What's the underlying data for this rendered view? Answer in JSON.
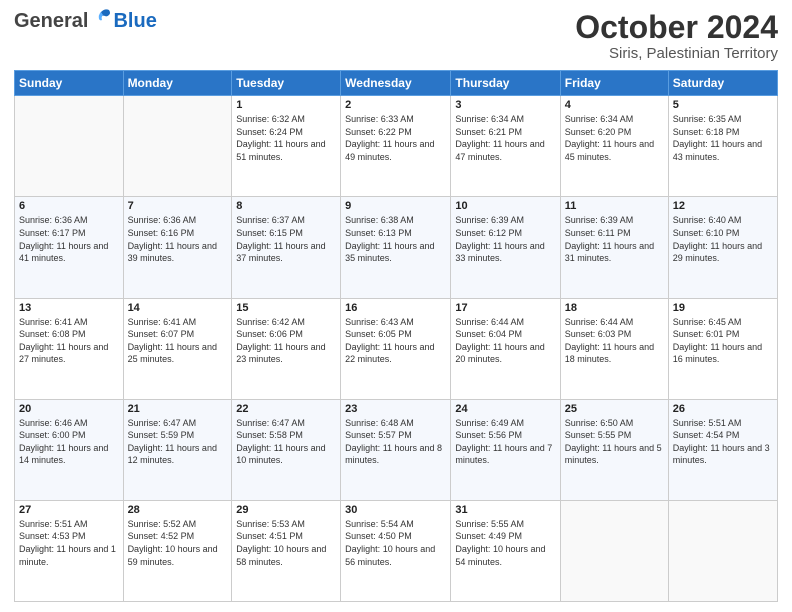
{
  "header": {
    "logo_general": "General",
    "logo_blue": "Blue",
    "month_title": "October 2024",
    "location": "Siris, Palestinian Territory"
  },
  "days_of_week": [
    "Sunday",
    "Monday",
    "Tuesday",
    "Wednesday",
    "Thursday",
    "Friday",
    "Saturday"
  ],
  "weeks": [
    [
      {
        "day": "",
        "info": ""
      },
      {
        "day": "",
        "info": ""
      },
      {
        "day": "1",
        "info": "Sunrise: 6:32 AM\nSunset: 6:24 PM\nDaylight: 11 hours and 51 minutes."
      },
      {
        "day": "2",
        "info": "Sunrise: 6:33 AM\nSunset: 6:22 PM\nDaylight: 11 hours and 49 minutes."
      },
      {
        "day": "3",
        "info": "Sunrise: 6:34 AM\nSunset: 6:21 PM\nDaylight: 11 hours and 47 minutes."
      },
      {
        "day": "4",
        "info": "Sunrise: 6:34 AM\nSunset: 6:20 PM\nDaylight: 11 hours and 45 minutes."
      },
      {
        "day": "5",
        "info": "Sunrise: 6:35 AM\nSunset: 6:18 PM\nDaylight: 11 hours and 43 minutes."
      }
    ],
    [
      {
        "day": "6",
        "info": "Sunrise: 6:36 AM\nSunset: 6:17 PM\nDaylight: 11 hours and 41 minutes."
      },
      {
        "day": "7",
        "info": "Sunrise: 6:36 AM\nSunset: 6:16 PM\nDaylight: 11 hours and 39 minutes."
      },
      {
        "day": "8",
        "info": "Sunrise: 6:37 AM\nSunset: 6:15 PM\nDaylight: 11 hours and 37 minutes."
      },
      {
        "day": "9",
        "info": "Sunrise: 6:38 AM\nSunset: 6:13 PM\nDaylight: 11 hours and 35 minutes."
      },
      {
        "day": "10",
        "info": "Sunrise: 6:39 AM\nSunset: 6:12 PM\nDaylight: 11 hours and 33 minutes."
      },
      {
        "day": "11",
        "info": "Sunrise: 6:39 AM\nSunset: 6:11 PM\nDaylight: 11 hours and 31 minutes."
      },
      {
        "day": "12",
        "info": "Sunrise: 6:40 AM\nSunset: 6:10 PM\nDaylight: 11 hours and 29 minutes."
      }
    ],
    [
      {
        "day": "13",
        "info": "Sunrise: 6:41 AM\nSunset: 6:08 PM\nDaylight: 11 hours and 27 minutes."
      },
      {
        "day": "14",
        "info": "Sunrise: 6:41 AM\nSunset: 6:07 PM\nDaylight: 11 hours and 25 minutes."
      },
      {
        "day": "15",
        "info": "Sunrise: 6:42 AM\nSunset: 6:06 PM\nDaylight: 11 hours and 23 minutes."
      },
      {
        "day": "16",
        "info": "Sunrise: 6:43 AM\nSunset: 6:05 PM\nDaylight: 11 hours and 22 minutes."
      },
      {
        "day": "17",
        "info": "Sunrise: 6:44 AM\nSunset: 6:04 PM\nDaylight: 11 hours and 20 minutes."
      },
      {
        "day": "18",
        "info": "Sunrise: 6:44 AM\nSunset: 6:03 PM\nDaylight: 11 hours and 18 minutes."
      },
      {
        "day": "19",
        "info": "Sunrise: 6:45 AM\nSunset: 6:01 PM\nDaylight: 11 hours and 16 minutes."
      }
    ],
    [
      {
        "day": "20",
        "info": "Sunrise: 6:46 AM\nSunset: 6:00 PM\nDaylight: 11 hours and 14 minutes."
      },
      {
        "day": "21",
        "info": "Sunrise: 6:47 AM\nSunset: 5:59 PM\nDaylight: 11 hours and 12 minutes."
      },
      {
        "day": "22",
        "info": "Sunrise: 6:47 AM\nSunset: 5:58 PM\nDaylight: 11 hours and 10 minutes."
      },
      {
        "day": "23",
        "info": "Sunrise: 6:48 AM\nSunset: 5:57 PM\nDaylight: 11 hours and 8 minutes."
      },
      {
        "day": "24",
        "info": "Sunrise: 6:49 AM\nSunset: 5:56 PM\nDaylight: 11 hours and 7 minutes."
      },
      {
        "day": "25",
        "info": "Sunrise: 6:50 AM\nSunset: 5:55 PM\nDaylight: 11 hours and 5 minutes."
      },
      {
        "day": "26",
        "info": "Sunrise: 5:51 AM\nSunset: 4:54 PM\nDaylight: 11 hours and 3 minutes."
      }
    ],
    [
      {
        "day": "27",
        "info": "Sunrise: 5:51 AM\nSunset: 4:53 PM\nDaylight: 11 hours and 1 minute."
      },
      {
        "day": "28",
        "info": "Sunrise: 5:52 AM\nSunset: 4:52 PM\nDaylight: 10 hours and 59 minutes."
      },
      {
        "day": "29",
        "info": "Sunrise: 5:53 AM\nSunset: 4:51 PM\nDaylight: 10 hours and 58 minutes."
      },
      {
        "day": "30",
        "info": "Sunrise: 5:54 AM\nSunset: 4:50 PM\nDaylight: 10 hours and 56 minutes."
      },
      {
        "day": "31",
        "info": "Sunrise: 5:55 AM\nSunset: 4:49 PM\nDaylight: 10 hours and 54 minutes."
      },
      {
        "day": "",
        "info": ""
      },
      {
        "day": "",
        "info": ""
      }
    ]
  ]
}
